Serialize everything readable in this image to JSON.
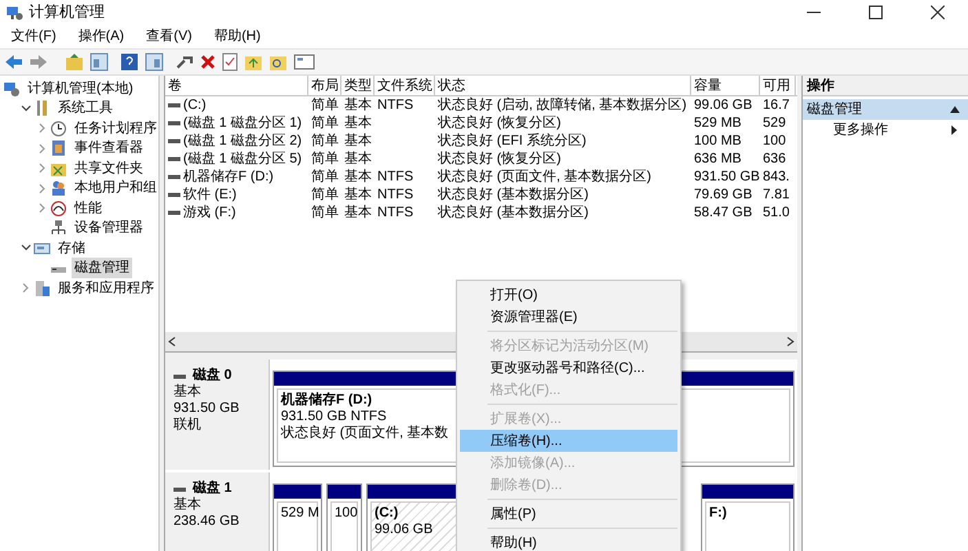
{
  "window": {
    "title": "计算机管理"
  },
  "menu_bar": [
    "文件(F)",
    "操作(A)",
    "查看(V)",
    "帮助(H)"
  ],
  "tree": [
    {
      "label": "计算机管理(本地)",
      "selected": false,
      "children": [
        {
          "label": "系统工具",
          "expanded": true,
          "selected": false,
          "children": [
            {
              "label": "任务计划程序",
              "expanded": false,
              "selected": false
            },
            {
              "label": "事件查看器",
              "expanded": false,
              "selected": false
            },
            {
              "label": "共享文件夹",
              "expanded": false,
              "selected": false
            },
            {
              "label": "本地用户和组",
              "expanded": false,
              "selected": false
            },
            {
              "label": "性能",
              "expanded": false,
              "selected": false
            },
            {
              "label": "设备管理器",
              "selected": false
            }
          ]
        },
        {
          "label": "存储",
          "expanded": true,
          "selected": false,
          "children": [
            {
              "label": "磁盘管理",
              "selected": true
            }
          ]
        },
        {
          "label": "服务和应用程序",
          "expanded": false,
          "selected": false
        }
      ]
    }
  ],
  "table": {
    "columns": [
      "卷",
      "布局",
      "类型",
      "文件系统",
      "状态",
      "容量",
      "可用"
    ],
    "rows": [
      [
        "(C:)",
        "简单",
        "基本",
        "NTFS",
        "状态良好 (启动, 故障转储, 基本数据分区)",
        "99.06 GB",
        "16.7"
      ],
      [
        "(磁盘 1 磁盘分区 1)",
        "简单",
        "基本",
        "",
        "状态良好 (恢复分区)",
        "529 MB",
        "529"
      ],
      [
        "(磁盘 1 磁盘分区 2)",
        "简单",
        "基本",
        "",
        "状态良好 (EFI 系统分区)",
        "100 MB",
        "100"
      ],
      [
        "(磁盘 1 磁盘分区 5)",
        "简单",
        "基本",
        "",
        "状态良好 (恢复分区)",
        "636 MB",
        "636"
      ],
      [
        "机器储存F (D:)",
        "简单",
        "基本",
        "NTFS",
        "状态良好 (页面文件, 基本数据分区)",
        "931.50 GB",
        "843."
      ],
      [
        "软件 (E:)",
        "简单",
        "基本",
        "NTFS",
        "状态良好 (基本数据分区)",
        "79.69 GB",
        "7.81"
      ],
      [
        "游戏 (F:)",
        "简单",
        "基本",
        "NTFS",
        "状态良好 (基本数据分区)",
        "58.47 GB",
        "51.0"
      ]
    ]
  },
  "disks": [
    {
      "name": "磁盘 0",
      "lines": [
        "基本",
        "931.50 GB",
        "联机"
      ],
      "partitions": [
        {
          "title": "机器储存F  (D:)",
          "lines": [
            "931.50 GB NTFS",
            "状态良好 (页面文件, 基本数"
          ]
        }
      ]
    },
    {
      "name": "磁盘 1",
      "lines": [
        "基本",
        "238.46 GB"
      ],
      "partitions": [
        {
          "lines": [
            "529 M"
          ]
        },
        {
          "lines": [
            "100"
          ]
        },
        {
          "title": "(C:)",
          "lines": [
            "99.06 GB"
          ]
        },
        {
          "title": "F:)"
        }
      ]
    }
  ],
  "actions": {
    "title": "操作",
    "items": [
      {
        "label": "磁盘管理",
        "kind": "section"
      },
      {
        "label": "更多操作",
        "kind": "submenu"
      }
    ]
  },
  "context_menu": [
    {
      "label": "打开(O)",
      "disabled": false,
      "selected": false,
      "separator_after": false
    },
    {
      "label": "资源管理器(E)",
      "disabled": false,
      "selected": false,
      "separator_after": true
    },
    {
      "label": "将分区标记为活动分区(M)",
      "disabled": true,
      "selected": false,
      "separator_after": false
    },
    {
      "label": "更改驱动器号和路径(C)...",
      "disabled": false,
      "selected": false,
      "separator_after": false
    },
    {
      "label": "格式化(F)...",
      "disabled": true,
      "selected": false,
      "separator_after": true
    },
    {
      "label": "扩展卷(X)...",
      "disabled": true,
      "selected": false,
      "separator_after": false
    },
    {
      "label": "压缩卷(H)...",
      "disabled": false,
      "selected": true,
      "separator_after": false
    },
    {
      "label": "添加镜像(A)...",
      "disabled": true,
      "selected": false,
      "separator_after": false
    },
    {
      "label": "删除卷(D)...",
      "disabled": true,
      "selected": false,
      "separator_after": true
    },
    {
      "label": "属性(P)",
      "disabled": false,
      "selected": false,
      "separator_after": true
    },
    {
      "label": "帮助(H)",
      "disabled": false,
      "selected": false,
      "separator_after": false
    }
  ]
}
